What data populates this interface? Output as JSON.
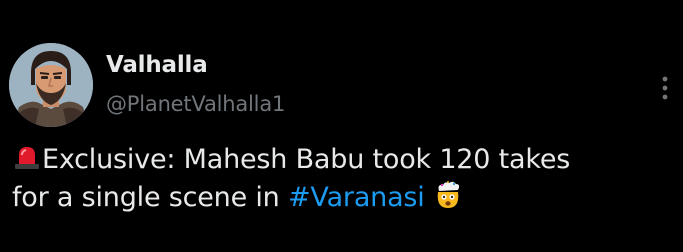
{
  "author": {
    "display_name": "Valhalla",
    "handle": "@PlanetValhalla1",
    "avatar_icon": "bearded-warrior-avatar"
  },
  "menu": {
    "icon": "more-vertical-icon"
  },
  "tweet": {
    "text_line1": "Exclusive: Mahesh Babu took 120 takes",
    "text_line2_prefix": "for a single scene in ",
    "hashtag": "#Varanasi",
    "leading_emoji": "rotating-light-siren-emoji",
    "trailing_emoji": "exploding-head-emoji"
  },
  "colors": {
    "background": "#000000",
    "text": "#e7e9ea",
    "secondary_text": "#71767b",
    "link": "#1d9bf0"
  }
}
